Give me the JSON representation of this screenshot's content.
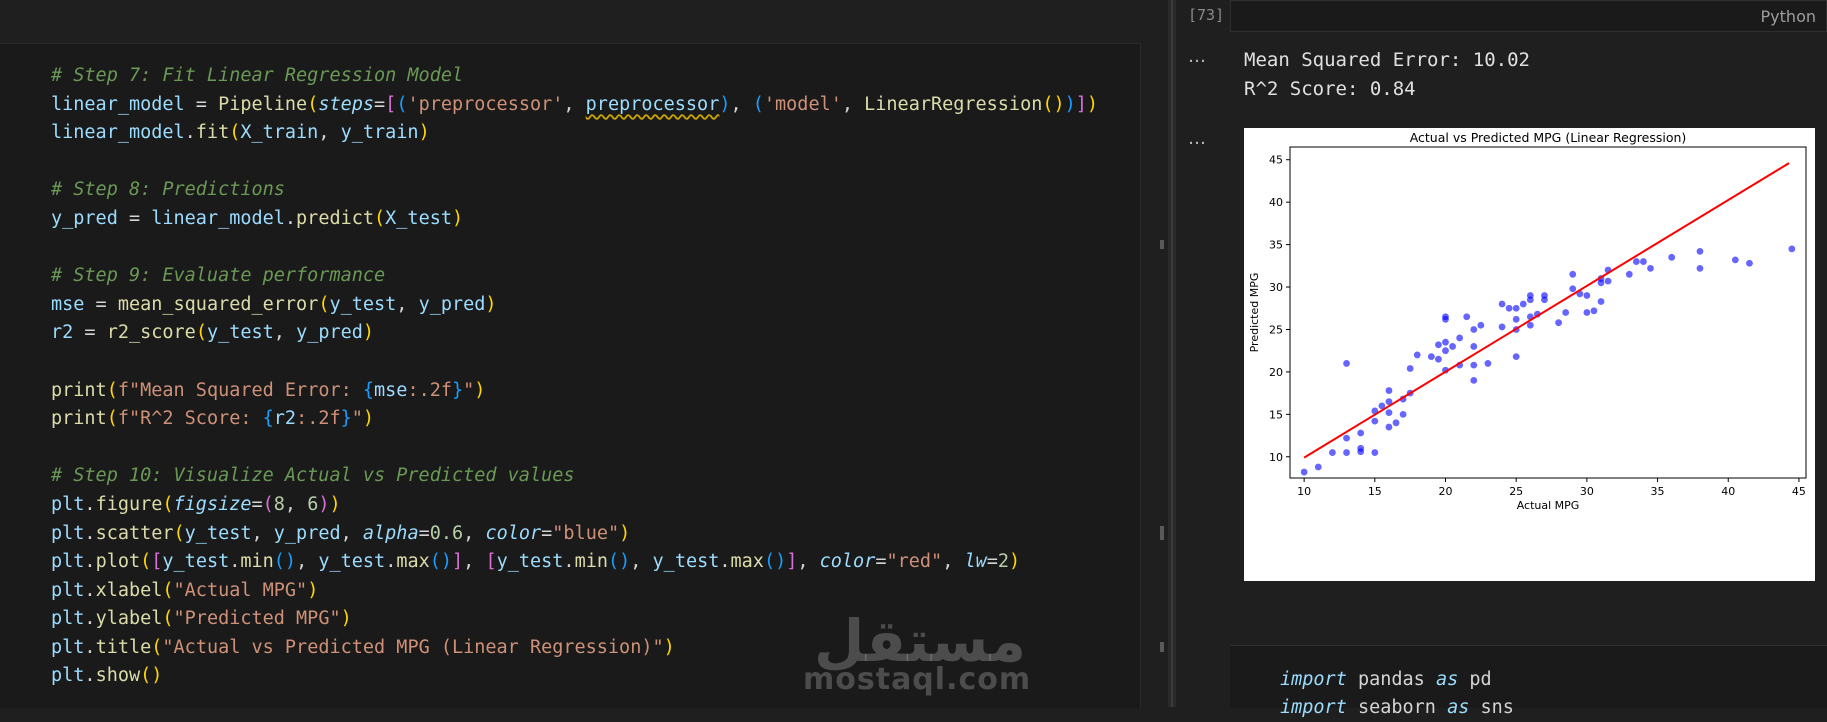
{
  "code_cell": {
    "lines": [
      [
        {
          "c": "cm",
          "t": "# Step 7: Fit Linear Regression Model"
        }
      ],
      [
        {
          "c": "vr",
          "t": "linear_model"
        },
        {
          "c": "pl",
          "t": " = "
        },
        {
          "c": "fn",
          "t": "Pipeline"
        },
        {
          "c": "b1",
          "t": "("
        },
        {
          "c": "ky",
          "t": "steps"
        },
        {
          "c": "pl",
          "t": "="
        },
        {
          "c": "b2",
          "t": "["
        },
        {
          "c": "b3",
          "t": "("
        },
        {
          "c": "st",
          "t": "'preprocessor'"
        },
        {
          "c": "pl",
          "t": ", "
        },
        {
          "c": "vr squig",
          "t": "preprocessor"
        },
        {
          "c": "b3",
          "t": ")"
        },
        {
          "c": "pl",
          "t": ", "
        },
        {
          "c": "b3",
          "t": "("
        },
        {
          "c": "st",
          "t": "'model'"
        },
        {
          "c": "pl",
          "t": ", "
        },
        {
          "c": "fn",
          "t": "LinearRegression"
        },
        {
          "c": "b1",
          "t": "()"
        },
        {
          "c": "b3",
          "t": ")"
        },
        {
          "c": "b2",
          "t": "]"
        },
        {
          "c": "b1",
          "t": ")"
        }
      ],
      [
        {
          "c": "vr",
          "t": "linear_model"
        },
        {
          "c": "pl",
          "t": "."
        },
        {
          "c": "fn",
          "t": "fit"
        },
        {
          "c": "b1",
          "t": "("
        },
        {
          "c": "vr",
          "t": "X_train"
        },
        {
          "c": "pl",
          "t": ", "
        },
        {
          "c": "vr",
          "t": "y_train"
        },
        {
          "c": "b1",
          "t": ")"
        }
      ],
      [],
      [
        {
          "c": "cm",
          "t": "# Step 8: Predictions"
        }
      ],
      [
        {
          "c": "vr",
          "t": "y_pred"
        },
        {
          "c": "pl",
          "t": " = "
        },
        {
          "c": "vr",
          "t": "linear_model"
        },
        {
          "c": "pl",
          "t": "."
        },
        {
          "c": "fn",
          "t": "predict"
        },
        {
          "c": "b1",
          "t": "("
        },
        {
          "c": "vr",
          "t": "X_test"
        },
        {
          "c": "b1",
          "t": ")"
        }
      ],
      [],
      [
        {
          "c": "cm",
          "t": "# Step 9: Evaluate performance"
        }
      ],
      [
        {
          "c": "vr",
          "t": "mse"
        },
        {
          "c": "pl",
          "t": " = "
        },
        {
          "c": "fn",
          "t": "mean_squared_error"
        },
        {
          "c": "b1",
          "t": "("
        },
        {
          "c": "vr",
          "t": "y_test"
        },
        {
          "c": "pl",
          "t": ", "
        },
        {
          "c": "vr",
          "t": "y_pred"
        },
        {
          "c": "b1",
          "t": ")"
        }
      ],
      [
        {
          "c": "vr",
          "t": "r2"
        },
        {
          "c": "pl",
          "t": " = "
        },
        {
          "c": "fn",
          "t": "r2_score"
        },
        {
          "c": "b1",
          "t": "("
        },
        {
          "c": "vr",
          "t": "y_test"
        },
        {
          "c": "pl",
          "t": ", "
        },
        {
          "c": "vr",
          "t": "y_pred"
        },
        {
          "c": "b1",
          "t": ")"
        }
      ],
      [],
      [
        {
          "c": "fn",
          "t": "print"
        },
        {
          "c": "b1",
          "t": "("
        },
        {
          "c": "st",
          "t": "f\"Mean Squared Error: "
        },
        {
          "c": "b3",
          "t": "{"
        },
        {
          "c": "vr",
          "t": "mse"
        },
        {
          "c": "st",
          "t": ":.2f"
        },
        {
          "c": "b3",
          "t": "}"
        },
        {
          "c": "st",
          "t": "\""
        },
        {
          "c": "b1",
          "t": ")"
        }
      ],
      [
        {
          "c": "fn",
          "t": "print"
        },
        {
          "c": "b1",
          "t": "("
        },
        {
          "c": "st",
          "t": "f\"R^2 Score: "
        },
        {
          "c": "b3",
          "t": "{"
        },
        {
          "c": "vr",
          "t": "r2"
        },
        {
          "c": "st",
          "t": ":.2f"
        },
        {
          "c": "b3",
          "t": "}"
        },
        {
          "c": "st",
          "t": "\""
        },
        {
          "c": "b1",
          "t": ")"
        }
      ],
      [],
      [
        {
          "c": "cm",
          "t": "# Step 10: Visualize Actual vs Predicted values"
        }
      ],
      [
        {
          "c": "vr",
          "t": "plt"
        },
        {
          "c": "pl",
          "t": "."
        },
        {
          "c": "fn",
          "t": "figure"
        },
        {
          "c": "b1",
          "t": "("
        },
        {
          "c": "ky",
          "t": "figsize"
        },
        {
          "c": "pl",
          "t": "="
        },
        {
          "c": "b2",
          "t": "("
        },
        {
          "c": "nm",
          "t": "8"
        },
        {
          "c": "pl",
          "t": ", "
        },
        {
          "c": "nm",
          "t": "6"
        },
        {
          "c": "b2",
          "t": ")"
        },
        {
          "c": "b1",
          "t": ")"
        }
      ],
      [
        {
          "c": "vr",
          "t": "plt"
        },
        {
          "c": "pl",
          "t": "."
        },
        {
          "c": "fn",
          "t": "scatter"
        },
        {
          "c": "b1",
          "t": "("
        },
        {
          "c": "vr",
          "t": "y_test"
        },
        {
          "c": "pl",
          "t": ", "
        },
        {
          "c": "vr",
          "t": "y_pred"
        },
        {
          "c": "pl",
          "t": ", "
        },
        {
          "c": "ky",
          "t": "alpha"
        },
        {
          "c": "pl",
          "t": "="
        },
        {
          "c": "nm",
          "t": "0.6"
        },
        {
          "c": "pl",
          "t": ", "
        },
        {
          "c": "ky",
          "t": "color"
        },
        {
          "c": "pl",
          "t": "="
        },
        {
          "c": "st",
          "t": "\"blue\""
        },
        {
          "c": "b1",
          "t": ")"
        }
      ],
      [
        {
          "c": "vr",
          "t": "plt"
        },
        {
          "c": "pl",
          "t": "."
        },
        {
          "c": "fn",
          "t": "plot"
        },
        {
          "c": "b1",
          "t": "("
        },
        {
          "c": "b2",
          "t": "["
        },
        {
          "c": "vr",
          "t": "y_test"
        },
        {
          "c": "pl",
          "t": "."
        },
        {
          "c": "fn",
          "t": "min"
        },
        {
          "c": "b3",
          "t": "()"
        },
        {
          "c": "pl",
          "t": ", "
        },
        {
          "c": "vr",
          "t": "y_test"
        },
        {
          "c": "pl",
          "t": "."
        },
        {
          "c": "fn",
          "t": "max"
        },
        {
          "c": "b3",
          "t": "()"
        },
        {
          "c": "b2",
          "t": "]"
        },
        {
          "c": "pl",
          "t": ", "
        },
        {
          "c": "b2",
          "t": "["
        },
        {
          "c": "vr",
          "t": "y_test"
        },
        {
          "c": "pl",
          "t": "."
        },
        {
          "c": "fn",
          "t": "min"
        },
        {
          "c": "b3",
          "t": "()"
        },
        {
          "c": "pl",
          "t": ", "
        },
        {
          "c": "vr",
          "t": "y_test"
        },
        {
          "c": "pl",
          "t": "."
        },
        {
          "c": "fn",
          "t": "max"
        },
        {
          "c": "b3",
          "t": "()"
        },
        {
          "c": "b2",
          "t": "]"
        },
        {
          "c": "pl",
          "t": ", "
        },
        {
          "c": "ky",
          "t": "color"
        },
        {
          "c": "pl",
          "t": "="
        },
        {
          "c": "st",
          "t": "\"red\""
        },
        {
          "c": "pl",
          "t": ", "
        },
        {
          "c": "ky",
          "t": "lw"
        },
        {
          "c": "pl",
          "t": "="
        },
        {
          "c": "nm",
          "t": "2"
        },
        {
          "c": "b1",
          "t": ")"
        }
      ],
      [
        {
          "c": "vr",
          "t": "plt"
        },
        {
          "c": "pl",
          "t": "."
        },
        {
          "c": "fn",
          "t": "xlabel"
        },
        {
          "c": "b1",
          "t": "("
        },
        {
          "c": "st",
          "t": "\"Actual MPG\""
        },
        {
          "c": "b1",
          "t": ")"
        }
      ],
      [
        {
          "c": "vr",
          "t": "plt"
        },
        {
          "c": "pl",
          "t": "."
        },
        {
          "c": "fn",
          "t": "ylabel"
        },
        {
          "c": "b1",
          "t": "("
        },
        {
          "c": "st",
          "t": "\"Predicted MPG\""
        },
        {
          "c": "b1",
          "t": ")"
        }
      ],
      [
        {
          "c": "vr",
          "t": "plt"
        },
        {
          "c": "pl",
          "t": "."
        },
        {
          "c": "fn",
          "t": "title"
        },
        {
          "c": "b1",
          "t": "("
        },
        {
          "c": "st",
          "t": "\"Actual vs Predicted MPG (Linear Regression)\""
        },
        {
          "c": "b1",
          "t": ")"
        }
      ],
      [
        {
          "c": "vr",
          "t": "plt"
        },
        {
          "c": "pl",
          "t": "."
        },
        {
          "c": "fn",
          "t": "show"
        },
        {
          "c": "b1",
          "t": "()"
        }
      ]
    ]
  },
  "output_cell": {
    "execution_count": "[73]",
    "language": "Python",
    "more_icon": "…",
    "lines": [
      "Mean Squared Error: 10.02",
      "R^2 Score: 0.84"
    ]
  },
  "next_cell": {
    "lines": [
      [
        {
          "c": "ky",
          "t": "import"
        },
        {
          "c": "pl",
          "t": " pandas "
        },
        {
          "c": "ky",
          "t": "as"
        },
        {
          "c": "pl",
          "t": " pd"
        }
      ],
      [
        {
          "c": "ky",
          "t": "import"
        },
        {
          "c": "pl",
          "t": " seaborn "
        },
        {
          "c": "ky",
          "t": "as"
        },
        {
          "c": "pl",
          "t": " sns"
        }
      ]
    ]
  },
  "watermark": {
    "arabic": "مستقل",
    "latin": "mostaql.com"
  },
  "chart_data": {
    "type": "scatter",
    "title": "Actual vs Predicted MPG (Linear Regression)",
    "xlabel": "Actual MPG",
    "ylabel": "Predicted MPG",
    "xlim": [
      9.0,
      45.5
    ],
    "ylim": [
      7.5,
      46.5
    ],
    "xticks": [
      10,
      15,
      20,
      25,
      30,
      35,
      40,
      45
    ],
    "yticks": [
      10,
      15,
      20,
      25,
      30,
      35,
      40,
      45
    ],
    "grid": false,
    "series": [
      {
        "color": "#0000ff",
        "alpha": 0.6,
        "points": [
          [
            10,
            8.2
          ],
          [
            11,
            8.8
          ],
          [
            12,
            10.5
          ],
          [
            13,
            10.5
          ],
          [
            13,
            21
          ],
          [
            13,
            12.2
          ],
          [
            14,
            11
          ],
          [
            14,
            10.6
          ],
          [
            14,
            12.8
          ],
          [
            15,
            10.5
          ],
          [
            15,
            14.2
          ],
          [
            15,
            15.4
          ],
          [
            15.5,
            16
          ],
          [
            16,
            13.5
          ],
          [
            16,
            15.2
          ],
          [
            16,
            16.5
          ],
          [
            16,
            17.8
          ],
          [
            16.5,
            14
          ],
          [
            17,
            15
          ],
          [
            17,
            16.8
          ],
          [
            17.5,
            17.5
          ],
          [
            17.5,
            20.4
          ],
          [
            18,
            22
          ],
          [
            19,
            21.8
          ],
          [
            19.5,
            23.2
          ],
          [
            19.5,
            21.5
          ],
          [
            20,
            26.5
          ],
          [
            20,
            26.2
          ],
          [
            20,
            23.5
          ],
          [
            20,
            22.5
          ],
          [
            20,
            20.2
          ],
          [
            20.5,
            23
          ],
          [
            21,
            20.8
          ],
          [
            21,
            24
          ],
          [
            21.5,
            26.5
          ],
          [
            22,
            23
          ],
          [
            22,
            25
          ],
          [
            22,
            19
          ],
          [
            22,
            20.8
          ],
          [
            22.5,
            25.5
          ],
          [
            23,
            21
          ],
          [
            24,
            25.3
          ],
          [
            24,
            28
          ],
          [
            24.5,
            27.5
          ],
          [
            25,
            21.8
          ],
          [
            25,
            25
          ],
          [
            25,
            27.5
          ],
          [
            25,
            26.2
          ],
          [
            25.5,
            28
          ],
          [
            26,
            28.5
          ],
          [
            26,
            29
          ],
          [
            26,
            25.5
          ],
          [
            26,
            26.5
          ],
          [
            26.5,
            26.8
          ],
          [
            27,
            28.5
          ],
          [
            27,
            29
          ],
          [
            28,
            25.8
          ],
          [
            28.5,
            27
          ],
          [
            29,
            29.8
          ],
          [
            29,
            31.5
          ],
          [
            29.5,
            29.2
          ],
          [
            30,
            29
          ],
          [
            30,
            27
          ],
          [
            30.5,
            27.2
          ],
          [
            31,
            28.3
          ],
          [
            31,
            30.5
          ],
          [
            31,
            31
          ],
          [
            31.5,
            30.7
          ],
          [
            31.5,
            32
          ],
          [
            33,
            31.5
          ],
          [
            33.5,
            33
          ],
          [
            34,
            33
          ],
          [
            34.5,
            32.2
          ],
          [
            36,
            33.5
          ],
          [
            38,
            32.2
          ],
          [
            38,
            34.2
          ],
          [
            40.5,
            33.2
          ],
          [
            41.5,
            32.8
          ],
          [
            44.5,
            34.5
          ]
        ]
      },
      {
        "color": "#ff0000",
        "lw": 2,
        "line": [
          [
            10,
            9.9
          ],
          [
            44.3,
            44.6
          ]
        ]
      }
    ]
  }
}
